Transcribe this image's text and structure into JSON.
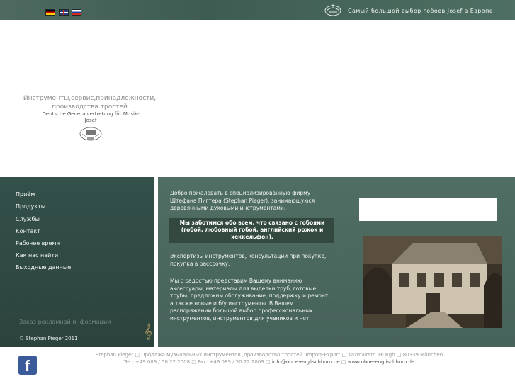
{
  "top_bar": {
    "tagline": "Самый большой выбор гобоев Josef в Европе",
    "languages": [
      "de",
      "en",
      "ru"
    ]
  },
  "header": {
    "title": "Инструменты,сервис,принадлежности, производства тростей",
    "subtitle": "Deutsche Generalvertretung für Musik-Josef"
  },
  "nav": {
    "items": [
      {
        "label": "Приём"
      },
      {
        "label": "Продукты"
      },
      {
        "label": "Службы"
      },
      {
        "label": "Контакт"
      },
      {
        "label": "Рабочее время"
      },
      {
        "label": "Как нас найти"
      },
      {
        "label": "Выходные данные"
      }
    ],
    "ad_link": "Заказ рекламной информации",
    "copyright": "© Stephan Pieger 2011"
  },
  "main": {
    "welcome": "Добро пожаловать в специализированную фирму Штефана Пигтера (Stephan Pieger), занимающуюся деревянными духовыми инструментами.",
    "highlight": "Мы заботимся обо всем, что связано с гобоями (гобой, любовный гобой, английский рожок и хеккельфон).",
    "expertise": "Экспертизы инструментов, консультации при покупке, покупка в рассрочку.",
    "offer": "Мы с радостью представим Вашему вниманию аксессуары, материалы для выделки труб, готовые трубы, предложим обслуживание, поддержку и ремонт, а также новые и б/у инструменты. В Вашем распоряжении большой выбор профессиональных инструментов, инструментов для учеников и нот."
  },
  "footer": {
    "line1": "Stephan Pieger □ Продажа музыкальных инструментов ,производство тростей. Import-Export □ Kazmairstr. 16 Rgb □ 80339 München",
    "line2_prefix": "Tel.: +49 089 / 50 22 2008 □ Fax: +49 089 / 50 22 2009 □ ",
    "email": "info@oboe-englischhorn.de",
    "sep": " □ ",
    "website": "www.oboe-englischhorn.de"
  },
  "icons": {
    "facebook": "facebook-icon",
    "clef": "treble-clef-icon",
    "logo": "oboe-logo-icon"
  },
  "colors": {
    "top_bar": "#46635a",
    "sidebar": "#2f4740",
    "main_panel": "#4b675d",
    "highlight": "#33493f",
    "clef": "#a39560"
  }
}
